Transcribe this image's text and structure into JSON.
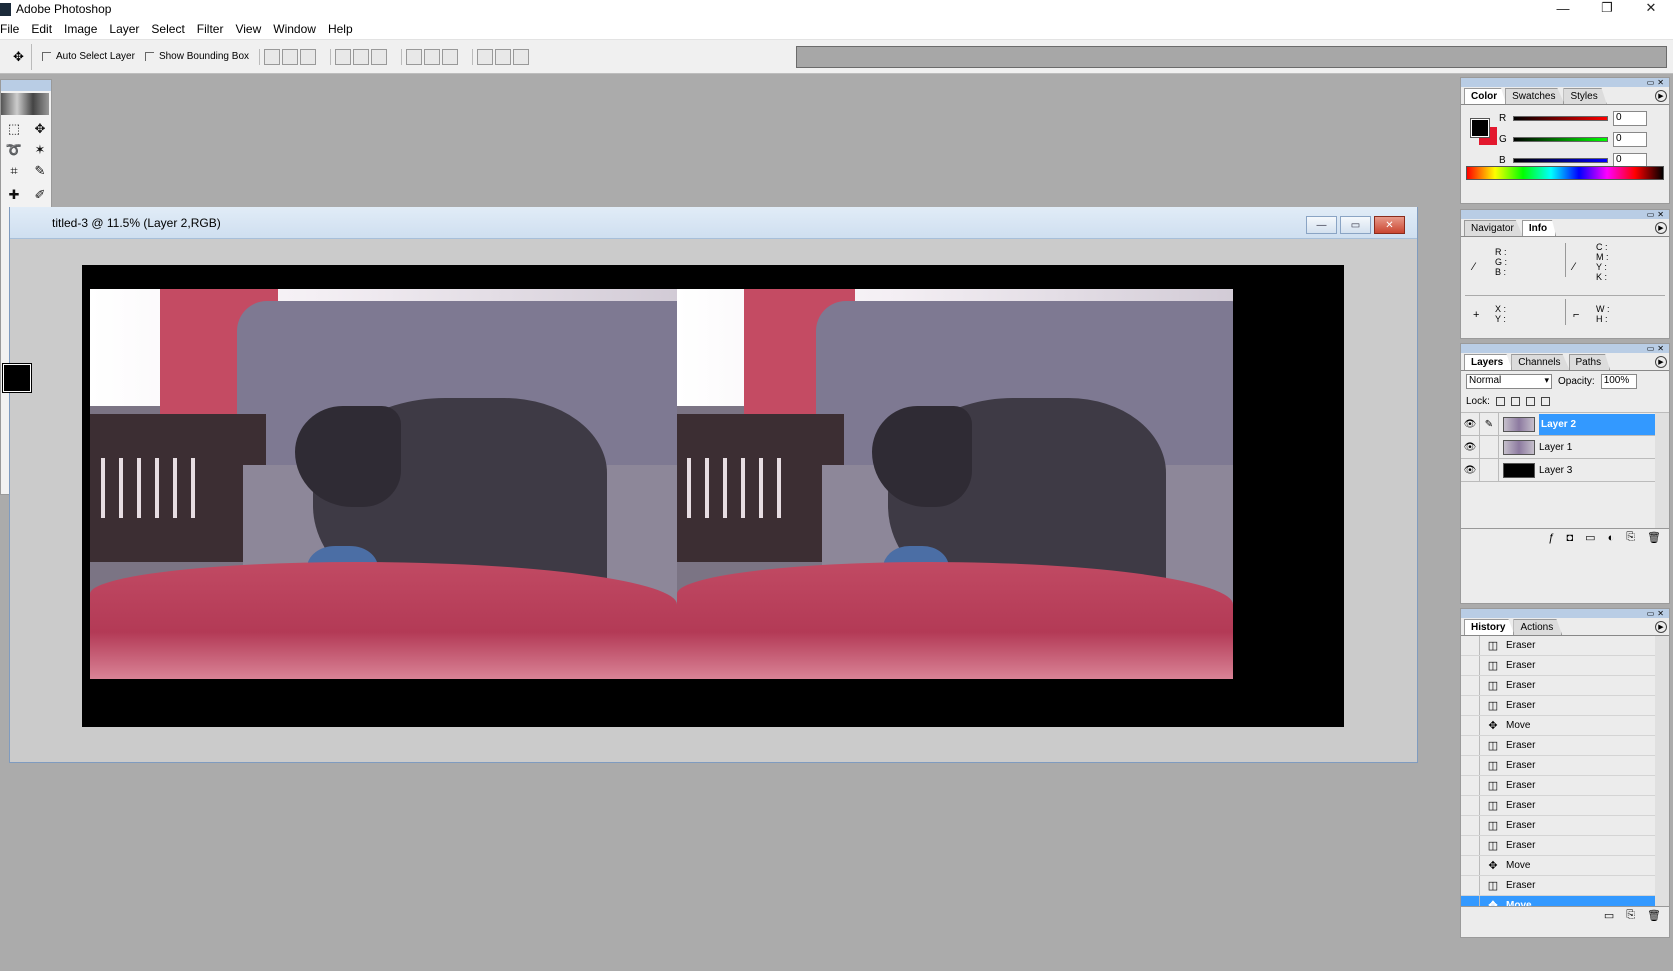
{
  "app": {
    "title": "Adobe Photoshop"
  },
  "window_controls": [
    "—",
    "❐",
    "✕"
  ],
  "menu": [
    "File",
    "Edit",
    "Image",
    "Layer",
    "Select",
    "Filter",
    "View",
    "Window",
    "Help"
  ],
  "options": {
    "auto_select": "Auto Select Layer",
    "bounding_box": "Show Bounding Box"
  },
  "document": {
    "title": "titled-3 @ 11.5% (Layer 2,RGB)",
    "zoom": "11.5%"
  },
  "color_panel": {
    "tabs": [
      "Color",
      "Swatches",
      "Styles"
    ],
    "r_label": "R",
    "g_label": "G",
    "b_label": "B",
    "r": "0",
    "g": "0",
    "b": "0",
    "fg_color": "#000000",
    "bg_color": "#e3182e"
  },
  "info_panel": {
    "tabs": [
      "Navigator",
      "Info"
    ],
    "rgb": "R :\nG :\nB :",
    "cmyk": "C :\nM :\nY :\nK :",
    "xy": "X :\nY :",
    "wh": "W :\nH :"
  },
  "layers_panel": {
    "tabs": [
      "Layers",
      "Channels",
      "Paths"
    ],
    "blend_mode": "Normal",
    "opacity_label": "Opacity:",
    "opacity": "100%",
    "lock_label": "Lock:",
    "layers": [
      {
        "name": "Layer 2",
        "selected": true
      },
      {
        "name": "Layer 1",
        "selected": false
      },
      {
        "name": "Layer 3",
        "selected": false
      }
    ]
  },
  "history_panel": {
    "tabs": [
      "History",
      "Actions"
    ],
    "items": [
      "Eraser",
      "Eraser",
      "Eraser",
      "Eraser",
      "Move",
      "Eraser",
      "Eraser",
      "Eraser",
      "Eraser",
      "Eraser",
      "Eraser",
      "Move",
      "Eraser",
      "Move"
    ],
    "selected_index": 13
  }
}
